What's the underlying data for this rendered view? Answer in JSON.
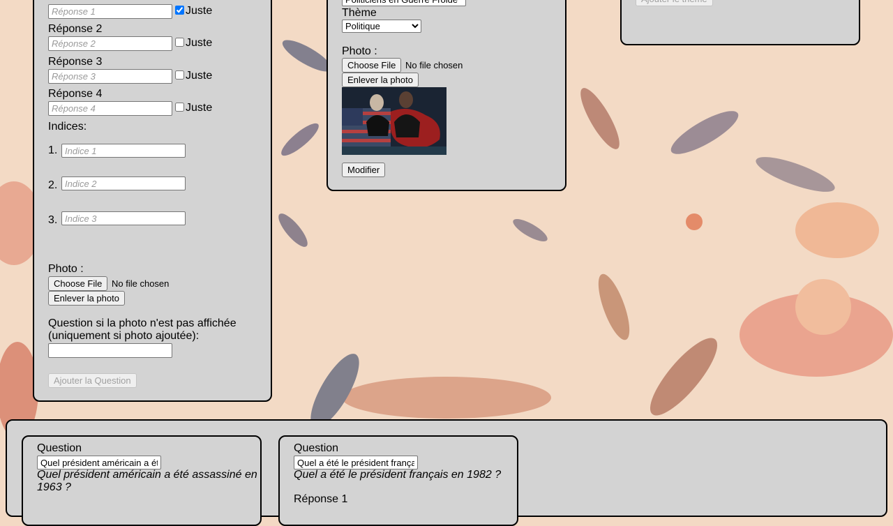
{
  "left_form": {
    "answers": [
      {
        "label": "",
        "placeholder": "Réponse 1",
        "correct_label": "Juste",
        "checked": true
      },
      {
        "label": "Réponse 2",
        "placeholder": "Réponse 2",
        "correct_label": "Juste",
        "checked": false
      },
      {
        "label": "Réponse 3",
        "placeholder": "Réponse 3",
        "correct_label": "Juste",
        "checked": false
      },
      {
        "label": "Réponse 4",
        "placeholder": "Réponse 4",
        "correct_label": "Juste",
        "checked": false
      }
    ],
    "hints_label": "Indices:",
    "hints": [
      {
        "number": "1.",
        "placeholder": "Indice 1"
      },
      {
        "number": "2.",
        "placeholder": "Indice 2"
      },
      {
        "number": "3.",
        "placeholder": "Indice 3"
      }
    ],
    "photo_label": "Photo :",
    "choose_file": "Choose File",
    "no_file": "No file chosen",
    "remove_photo": "Enlever la photo",
    "fallback_question_label": "Question si la photo n'est pas affichée (uniquement si photo ajoutée):",
    "fallback_question_value": "",
    "submit": "Ajouter la Question"
  },
  "middle_form": {
    "top_value": "Politiciens en Guerre Froide",
    "theme_label": "Thème",
    "theme_selected": "Politique",
    "photo_label": "Photo :",
    "choose_file": "Choose File",
    "no_file": "No file chosen",
    "remove_photo": "Enlever la photo",
    "modify": "Modifier"
  },
  "right_form": {
    "add_theme": "Ajouter le thème"
  },
  "bottom": {
    "cards": [
      {
        "question_label": "Question",
        "question_value": "Quel président américain a été assassiné en 1963 ?",
        "question_display": "Quel président américain a été assassiné en 1963 ?"
      },
      {
        "question_label": "Question",
        "question_value": "Quel a été le président français en 1982 ?",
        "question_display": "Quel a été le président français en 1982 ?",
        "answer_label": "Réponse 1"
      }
    ]
  },
  "colors": {
    "panel": "#d3d3d3",
    "background": "#f3d9c4"
  }
}
